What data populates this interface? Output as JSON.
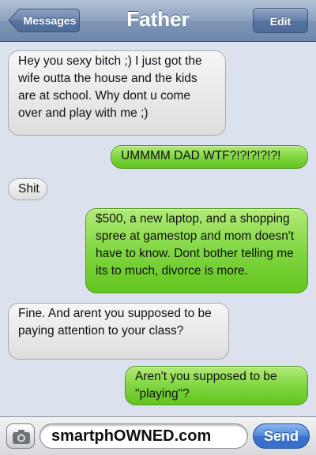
{
  "header": {
    "back_label": "Messages",
    "title": "Father",
    "edit_label": "Edit"
  },
  "messages": [
    {
      "direction": "incoming",
      "text": "Hey you sexy bitch ;) I just got the wife outta the house and the kids are at school. Why dont u come over and play with me ;)"
    },
    {
      "direction": "outgoing",
      "text": "UMMMM DAD WTF?!?!?!?!?!"
    },
    {
      "direction": "incoming",
      "text": "Shit"
    },
    {
      "direction": "outgoing",
      "text": "$500, a new laptop, and a shopping spree at gamestop and mom doesn't have to know. Dont bother telling me its to much, divorce is more."
    },
    {
      "direction": "incoming",
      "text": "Fine. And arent you supposed to be paying attention to your class?"
    },
    {
      "direction": "outgoing",
      "text": "Aren't you supposed to be \"playing\"?"
    }
  ],
  "composer": {
    "text_value": "smartphOWNED.com",
    "send_label": "Send",
    "camera_icon": "camera-icon"
  },
  "colors": {
    "incoming_bubble": "#e6e6e6",
    "outgoing_bubble": "#7cd53d",
    "background": "#dbe2ed",
    "navbar": "#7f96b6",
    "send_button": "#3b72cf"
  }
}
